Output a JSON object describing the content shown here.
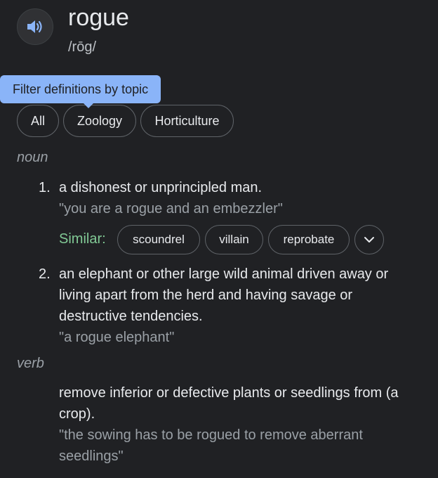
{
  "entry": {
    "word": "rogue",
    "phonetic": "/rōg/",
    "speaker_icon": "speaker-icon"
  },
  "tooltip": {
    "text": "Filter definitions by topic"
  },
  "filters": [
    {
      "label": "All"
    },
    {
      "label": "Zoology"
    },
    {
      "label": "Horticulture"
    }
  ],
  "noun": {
    "label": "noun",
    "definitions": [
      {
        "number": "1.",
        "text": "a dishonest or unprincipled man.",
        "example": "\"you are a rogue and an embezzler\"",
        "similar_label": "Similar:",
        "similar": [
          "scoundrel",
          "villain",
          "reprobate"
        ],
        "expand_icon": "chevron-down-icon"
      },
      {
        "number": "2.",
        "text_lines": [
          "an elephant or other large wild animal driven away or",
          "living apart from the herd and having savage or",
          "destructive tendencies."
        ],
        "example": "\"a rogue elephant\""
      }
    ]
  },
  "verb": {
    "label": "verb",
    "definition_lines": [
      "remove inferior or defective plants or seedlings from (a",
      "crop)."
    ],
    "example_lines": [
      "\"the sowing has to be rogued to remove aberrant",
      "seedlings\""
    ]
  },
  "colors": {
    "background": "#202124",
    "text": "#e8eaed",
    "muted": "#9aa0a6",
    "accent_blue": "#8ab4f8",
    "similar_green": "#81c995",
    "chip_border": "#5f6368"
  }
}
